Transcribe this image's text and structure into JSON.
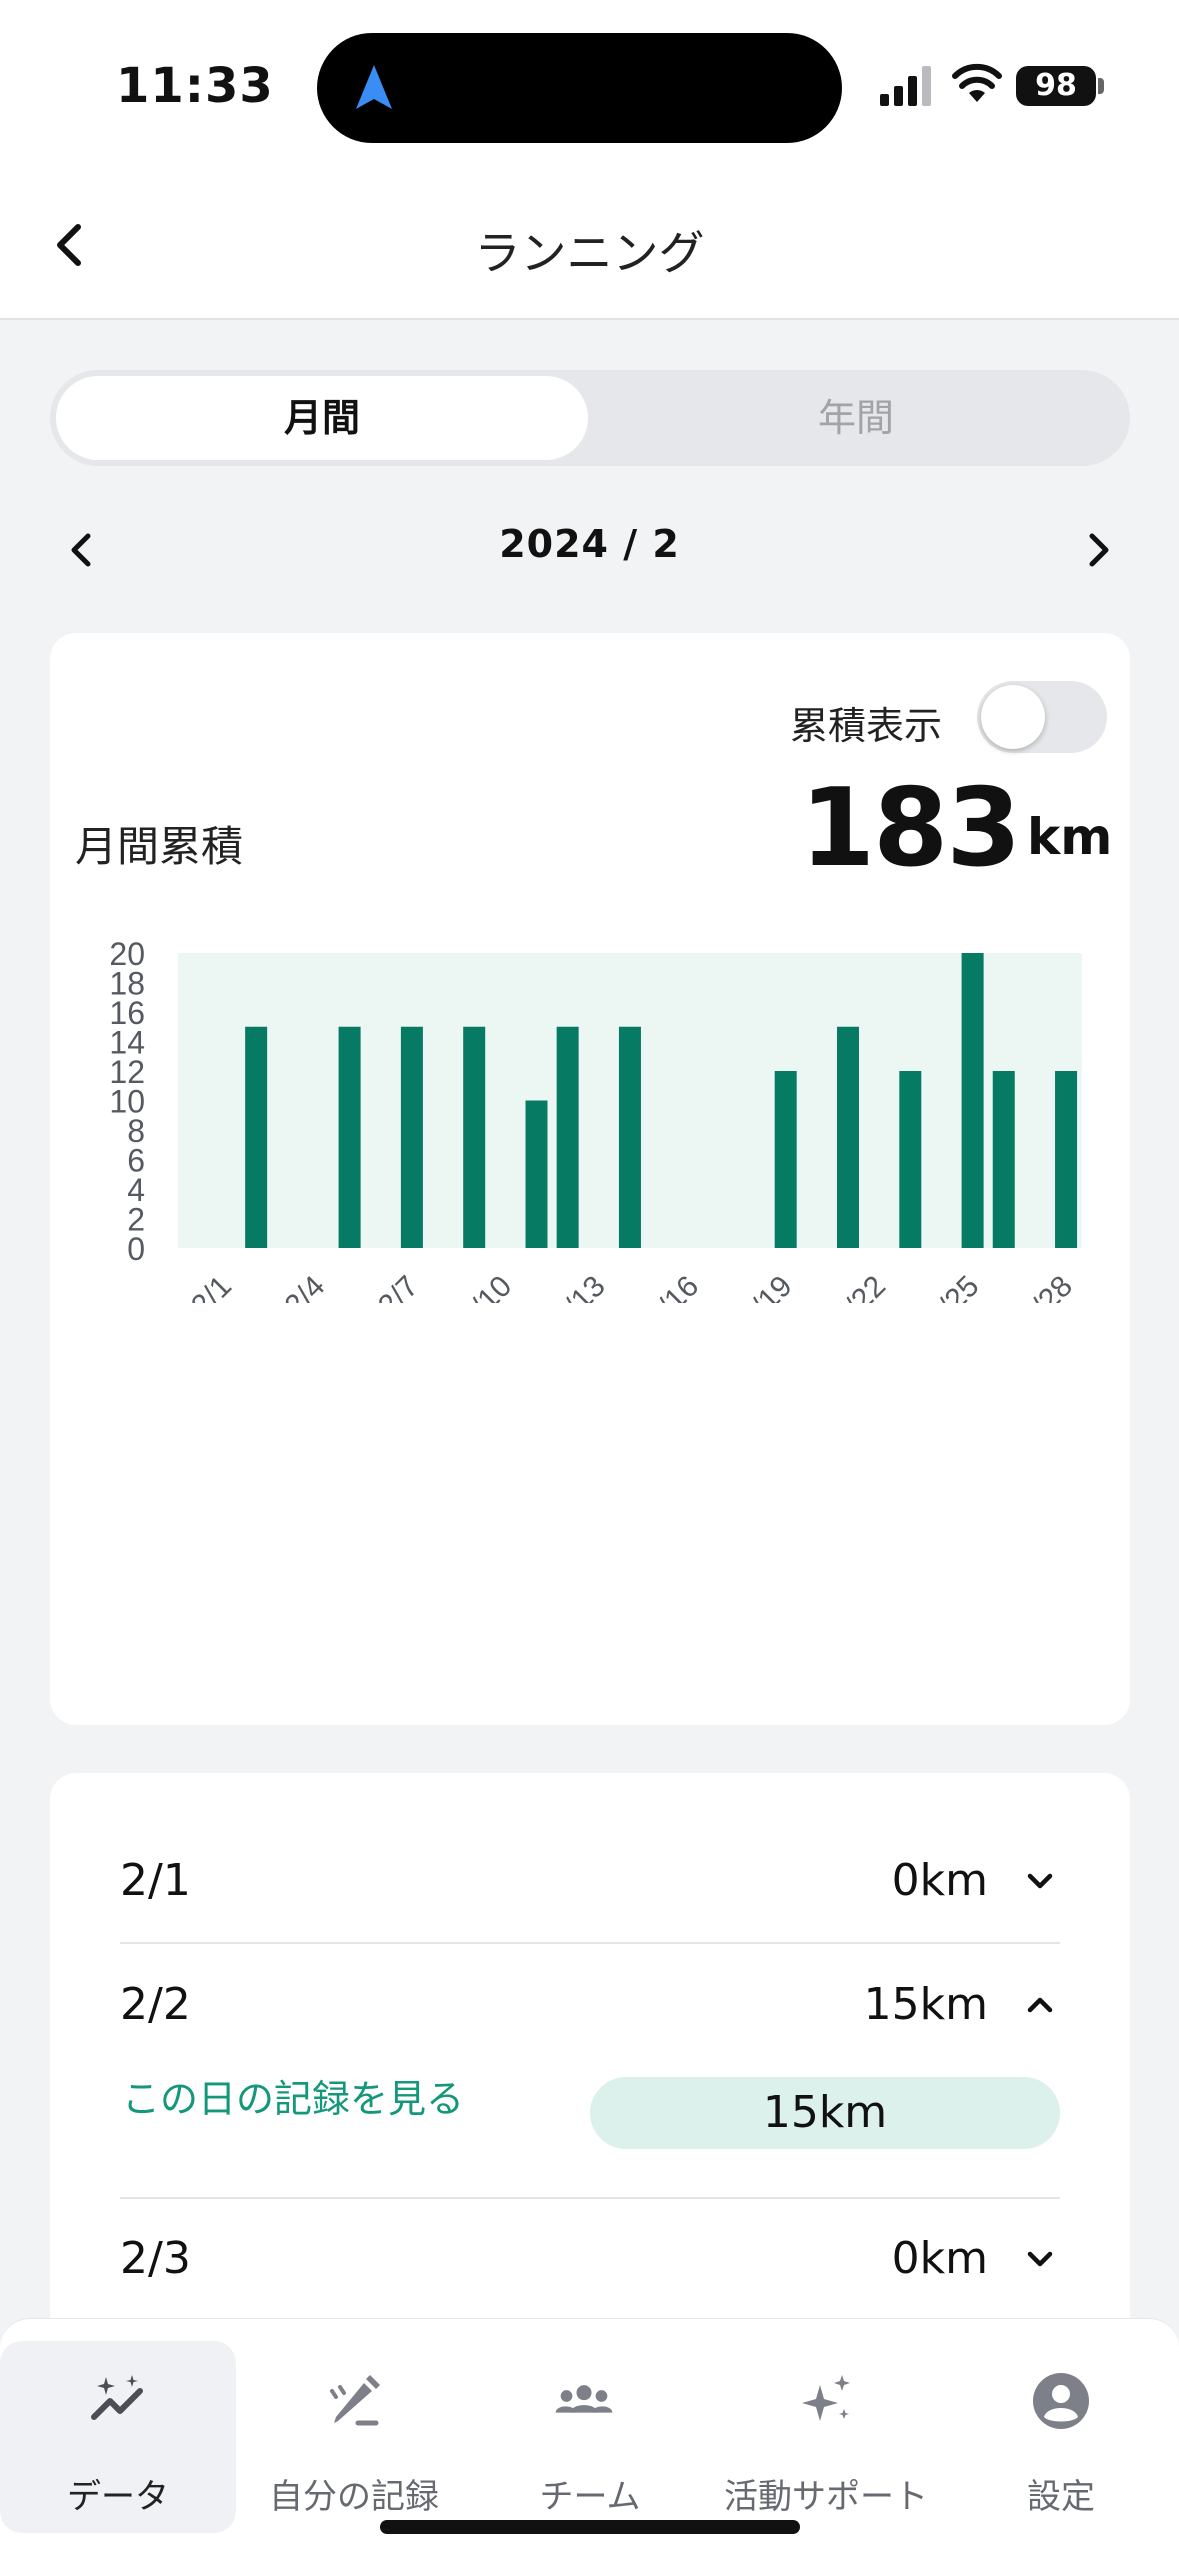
{
  "status_bar": {
    "time": "11:33",
    "battery": "98"
  },
  "header": {
    "title": "ランニング"
  },
  "segment": {
    "monthly": "月間",
    "yearly": "年間",
    "selected": "月間"
  },
  "month_selector": {
    "label": "2024 / 2"
  },
  "summary": {
    "toggle_label": "累積表示",
    "toggle_on": false,
    "label": "月間累積",
    "value": "183",
    "unit": "km"
  },
  "chart_data": {
    "type": "bar",
    "title": "",
    "xlabel": "",
    "ylabel": "",
    "ylim": [
      0,
      20
    ],
    "yticks": [
      0,
      2,
      4,
      6,
      8,
      10,
      12,
      14,
      16,
      18,
      20
    ],
    "x_tick_labels": [
      "2/1",
      "2/4",
      "2/7",
      "2/10",
      "2/13",
      "2/16",
      "2/19",
      "2/22",
      "2/25",
      "2/28"
    ],
    "categories": [
      "2/1",
      "2/2",
      "2/3",
      "2/4",
      "2/5",
      "2/6",
      "2/7",
      "2/8",
      "2/9",
      "2/10",
      "2/11",
      "2/12",
      "2/13",
      "2/14",
      "2/15",
      "2/16",
      "2/17",
      "2/18",
      "2/19",
      "2/20",
      "2/21",
      "2/22",
      "2/23",
      "2/24",
      "2/25",
      "2/26",
      "2/27",
      "2/28",
      "2/29"
    ],
    "values": [
      0,
      15,
      0,
      0,
      15,
      0,
      15,
      0,
      15,
      0,
      10,
      15,
      0,
      15,
      0,
      0,
      0,
      0,
      12,
      0,
      15,
      0,
      12,
      0,
      20,
      12,
      0,
      12,
      0
    ],
    "bar_color": "#077a63",
    "plot_background": "#ecf6f3"
  },
  "daily": {
    "rows": [
      {
        "date": "2/1",
        "km": "0km",
        "expanded": false
      },
      {
        "date": "2/2",
        "km": "15km",
        "expanded": true,
        "link": "この日の記録を見る",
        "detail": "15km"
      },
      {
        "date": "2/3",
        "km": "0km",
        "expanded": false
      }
    ]
  },
  "tabbar": {
    "items": [
      {
        "label": "データ",
        "icon": "chart-sparkle-icon",
        "active": true
      },
      {
        "label": "自分の記録",
        "icon": "pencil-edit-icon",
        "active": false
      },
      {
        "label": "チーム",
        "icon": "team-icon",
        "active": false
      },
      {
        "label": "活動サポート",
        "icon": "sparkle-icon",
        "active": false
      },
      {
        "label": "設定",
        "icon": "profile-icon",
        "active": false
      }
    ]
  },
  "colors": {
    "accent": "#077a63",
    "link": "#14977a",
    "pill": "#dcf0ec"
  }
}
